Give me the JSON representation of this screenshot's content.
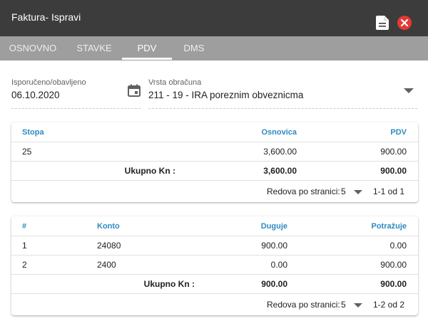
{
  "window": {
    "title": "Faktura- Ispravi"
  },
  "tabs": [
    {
      "label": "OSNOVNO",
      "active": false
    },
    {
      "label": "STAVKE",
      "active": false
    },
    {
      "label": "PDV",
      "active": true
    },
    {
      "label": "DMS",
      "active": false
    }
  ],
  "form": {
    "date_label": "Isporučeno/obavljeno",
    "date_value": "06.10.2020",
    "calc_label": "Vrsta obračuna",
    "calc_value": "211 - 19 - IRA poreznim obveznicma"
  },
  "pdv_table": {
    "headers": {
      "stopa": "Stopa",
      "osnovica": "Osnovica",
      "pdv": "PDV"
    },
    "rows": [
      {
        "stopa": "25",
        "osnovica": "3,600.00",
        "pdv": "900.00"
      }
    ],
    "total": {
      "label": "Ukupno Kn :",
      "osnovica": "3,600.00",
      "pdv": "900.00"
    },
    "pager": {
      "rows_label": "Redova po stranici:",
      "page_size": "5",
      "range": "1-1 od 1"
    }
  },
  "konto_table": {
    "headers": {
      "num": "#",
      "konto": "Konto",
      "duguje": "Duguje",
      "potrazuje": "Potražuje"
    },
    "rows": [
      {
        "num": "1",
        "konto": "24080",
        "duguje": "900.00",
        "potrazuje": "0.00"
      },
      {
        "num": "2",
        "konto": "2400",
        "duguje": "0.00",
        "potrazuje": "900.00"
      }
    ],
    "total": {
      "label": "Ukupno Kn :",
      "duguje": "900.00",
      "potrazuje": "900.00"
    },
    "pager": {
      "rows_label": "Redova po stranici:",
      "page_size": "5",
      "range": "1-2 od 2"
    }
  },
  "colors": {
    "titlebar": "#3c3c3c",
    "tabbar": "#9e9e9e",
    "header_text": "#2e8bc0",
    "close_button": "#e53935"
  },
  "icons": {
    "document": "document-icon",
    "close": "close-icon",
    "calendar": "calendar-icon",
    "dropdown": "chevron-down-icon"
  }
}
